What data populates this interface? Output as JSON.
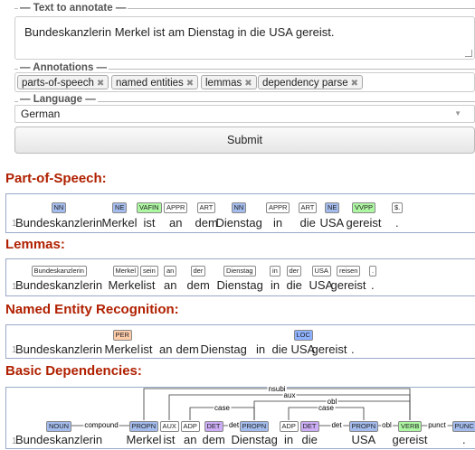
{
  "form": {
    "text_legend": "— Text to annotate —",
    "text_value": "Bundeskanzlerin Merkel ist am Dienstag in die USA gereist.",
    "annotations_legend": "— Annotations —",
    "tags": [
      {
        "label": "parts-of-speech"
      },
      {
        "label": "named entities"
      },
      {
        "label": "lemmas"
      },
      {
        "label": "dependency parse"
      }
    ],
    "tag_remove_glyph": "✖",
    "language_legend": "— Language —",
    "language_value": "German",
    "submit_label": "Submit"
  },
  "sections": {
    "pos_title": "Part-of-Speech:",
    "lemmas_title": "Lemmas:",
    "ner_title": "Named Entity Recognition:",
    "deps_title": "Basic Dependencies:"
  },
  "line_number": "1",
  "tokens": [
    "Bundeskanzlerin",
    "Merkel",
    "ist",
    "an",
    "dem",
    "Dienstag",
    "in",
    "die",
    "USA",
    "gereist",
    "."
  ],
  "pos_tags": [
    "NN",
    "NE",
    "VAFIN",
    "APPR",
    "ART",
    "NN",
    "APPR",
    "ART",
    "NE",
    "VVPP",
    "$."
  ],
  "lemmas": [
    "Bundeskanzlerin",
    "Merkel",
    "sein",
    "an",
    "der",
    "Dienstag",
    "in",
    "der",
    "USA",
    "reisen",
    "."
  ],
  "ner": [
    {
      "label": "PER",
      "token": 1
    },
    {
      "label": "LOC",
      "token": 8
    }
  ],
  "ner_sentence": "Bundeskanzlerin Merkel ist an dem Dienstag in die USA gereist .",
  "upos_tags": [
    "NOUN",
    "PROPN",
    "AUX",
    "ADP",
    "DET",
    "PROPN",
    "ADP",
    "DET",
    "PROPN",
    "VERB",
    "PUNC"
  ],
  "dependencies": [
    {
      "label": "compound",
      "from": 1,
      "to": 0
    },
    {
      "label": "nsubj",
      "from": 9,
      "to": 1
    },
    {
      "label": "aux",
      "from": 9,
      "to": 2
    },
    {
      "label": "case",
      "from": 5,
      "to": 3
    },
    {
      "label": "det",
      "from": 5,
      "to": 4
    },
    {
      "label": "obl",
      "from": 9,
      "to": 5
    },
    {
      "label": "case",
      "from": 8,
      "to": 6
    },
    {
      "label": "det",
      "from": 8,
      "to": 7
    },
    {
      "label": "obl",
      "from": 9,
      "to": 8
    },
    {
      "label": "punct",
      "from": 9,
      "to": 10
    }
  ],
  "colors": {
    "section_title": "#b02000",
    "panel_border": "#9aa9c8",
    "noun_tag": "#a4bced",
    "verb_tag": "#adf6a2",
    "det_tag": "#ccadf6",
    "per_tag": "#ffccaa",
    "loc_tag": "#8fb2ff"
  }
}
